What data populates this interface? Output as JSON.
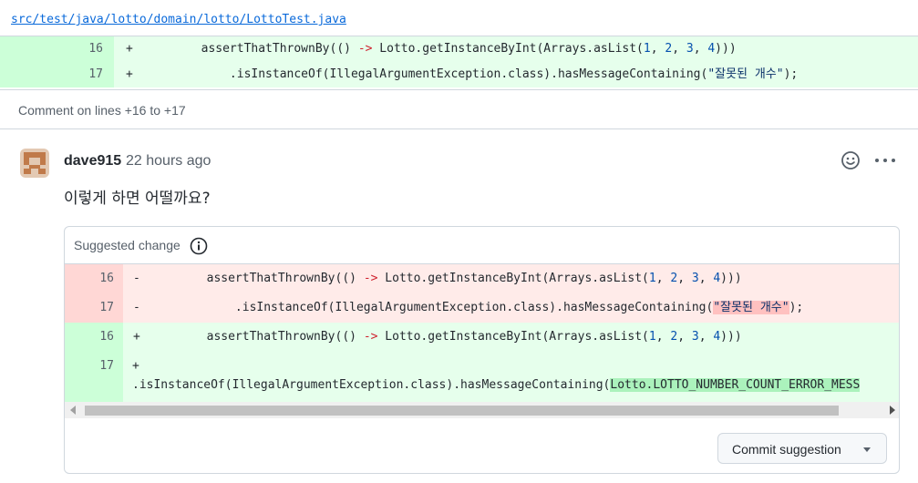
{
  "file": {
    "path": "src/test/java/lotto/domain/lotto/LottoTest.java"
  },
  "top_diff": [
    {
      "line": "16",
      "marker": "+",
      "code_prefix": "        assertThatThrownBy(() ",
      "code_arrow": "->",
      "code_mid": " Lotto.getInstanceByInt(Arrays.asList(",
      "n1": "1",
      "sep1": ", ",
      "n2": "2",
      "sep2": ", ",
      "n3": "3",
      "sep3": ", ",
      "n4": "4",
      "code_end": ")))"
    },
    {
      "line": "17",
      "marker": "+",
      "code_prefix": "            .isInstanceOf(IllegalArgumentException.class).hasMessageContaining(",
      "string": "\"잘못된 개수\"",
      "code_end": ");"
    }
  ],
  "comment_on": "Comment on lines +16 to +17",
  "comment": {
    "author": "dave915",
    "time": "22 hours ago",
    "body": "이렇게 하면 어떨까요?"
  },
  "icons": {
    "reaction": "smiley-icon",
    "more": "kebab-horizontal-icon",
    "info": "info-icon"
  },
  "suggestion": {
    "header": "Suggested change",
    "del_rows": [
      {
        "line": "16",
        "marker": "-",
        "code_prefix": "        assertThatThrownBy(() ",
        "code_arrow": "->",
        "code_mid": " Lotto.getInstanceByInt(Arrays.asList(",
        "n1": "1",
        "sep1": ", ",
        "n2": "2",
        "sep2": ", ",
        "n3": "3",
        "sep3": ", ",
        "n4": "4",
        "code_end": ")))"
      },
      {
        "line": "17",
        "marker": "-",
        "code_prefix": "            .isInstanceOf(IllegalArgumentException.class).hasMessageContaining(",
        "string": "\"잘못된 개수\"",
        "code_end": ");"
      }
    ],
    "add_rows": [
      {
        "line": "16",
        "marker": "+",
        "code_prefix": "        assertThatThrownBy(() ",
        "code_arrow": "->",
        "code_mid": " Lotto.getInstanceByInt(Arrays.asList(",
        "n1": "1",
        "sep1": ", ",
        "n2": "2",
        "sep2": ", ",
        "n3": "3",
        "sep3": ", ",
        "n4": "4",
        "code_end": ")))"
      },
      {
        "line": "17",
        "marker": "+",
        "code_line2": ".isInstanceOf(IllegalArgumentException.class).hasMessageContaining(",
        "highlight": "Lotto.LOTTO_NUMBER_COUNT_ERROR_MESS"
      }
    ],
    "commit_button": "Commit suggestion"
  }
}
